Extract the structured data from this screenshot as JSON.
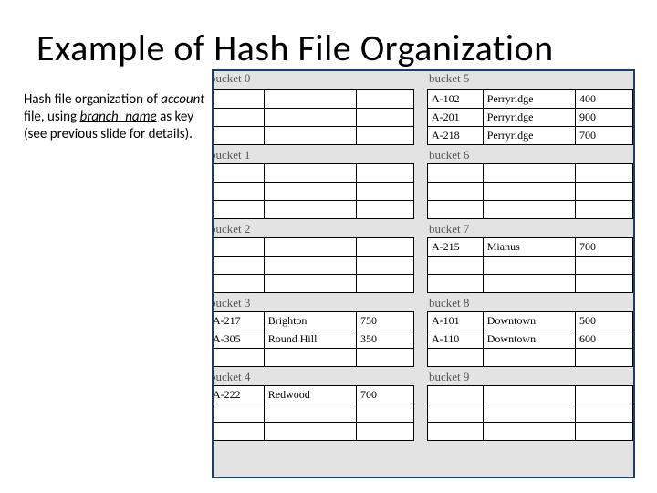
{
  "title": "Example of Hash File Organization",
  "desc": {
    "t1": "Hash file organization of ",
    "account": "account",
    "t2": " file, using ",
    "branch": "branch_name",
    "t3": " as key (see previous slide for details)."
  },
  "rows_per_bucket": 3,
  "left_buckets": [
    {
      "label": "bucket 0",
      "rows": []
    },
    {
      "label": "bucket 1",
      "rows": []
    },
    {
      "label": "bucket 2",
      "rows": []
    },
    {
      "label": "bucket 3",
      "rows": [
        {
          "acct": "A-217",
          "branch": "Brighton",
          "amt": "750"
        },
        {
          "acct": "A-305",
          "branch": "Round Hill",
          "amt": "350"
        }
      ]
    },
    {
      "label": "bucket 4",
      "rows": [
        {
          "acct": "A-222",
          "branch": "Redwood",
          "amt": "700"
        }
      ]
    }
  ],
  "right_buckets": [
    {
      "label": "bucket 5",
      "rows": [
        {
          "acct": "A-102",
          "branch": "Perryridge",
          "amt": "400"
        },
        {
          "acct": "A-201",
          "branch": "Perryridge",
          "amt": "900"
        },
        {
          "acct": "A-218",
          "branch": "Perryridge",
          "amt": "700"
        }
      ]
    },
    {
      "label": "bucket 6",
      "rows": []
    },
    {
      "label": "bucket 7",
      "rows": [
        {
          "acct": "A-215",
          "branch": "Mianus",
          "amt": "700"
        }
      ]
    },
    {
      "label": "bucket 8",
      "rows": [
        {
          "acct": "A-101",
          "branch": "Downtown",
          "amt": "500"
        },
        {
          "acct": "A-110",
          "branch": "Downtown",
          "amt": "600"
        }
      ]
    },
    {
      "label": "bucket 9",
      "rows": []
    }
  ]
}
